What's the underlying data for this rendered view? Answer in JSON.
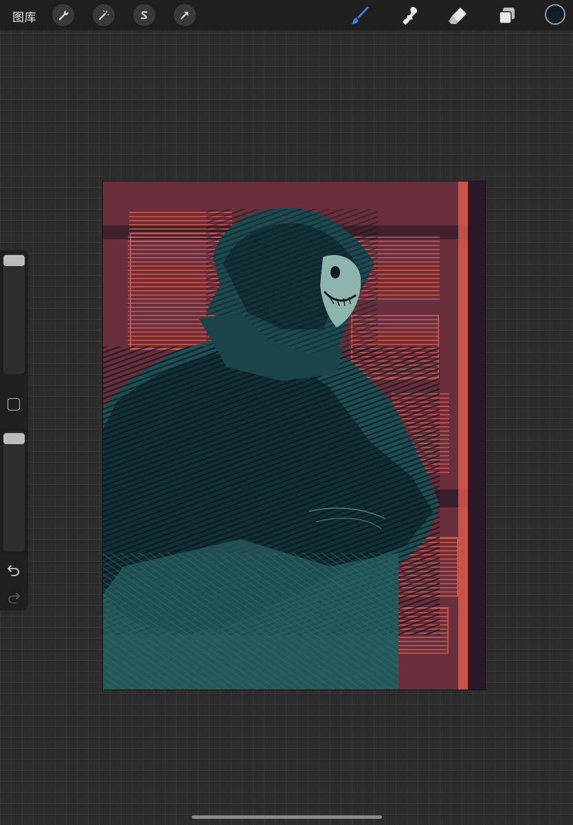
{
  "toolbar": {
    "gallery_label": "图库",
    "left_tools": [
      "wrench-icon",
      "magic-wand-icon",
      "selection-s-icon",
      "transform-arrow-icon"
    ],
    "right_tools": [
      "brush-icon",
      "smudge-icon",
      "eraser-icon",
      "layers-icon"
    ],
    "active_tool": "brush-icon",
    "current_color": "#0f1e28",
    "active_tool_color": "#3a7bf0"
  },
  "sidebar": {
    "brush_size_level": 0.0,
    "opacity_level": 0.0,
    "icons": [
      "modify-square-icon",
      "undo-icon",
      "redo-icon"
    ]
  },
  "canvas": {
    "artwork_subject": "",
    "palette": {
      "background": "#6a2f3d",
      "accent_red": "#d9584a",
      "figure_teal": "#1f4f52",
      "shadow": "#0f1a22"
    }
  }
}
